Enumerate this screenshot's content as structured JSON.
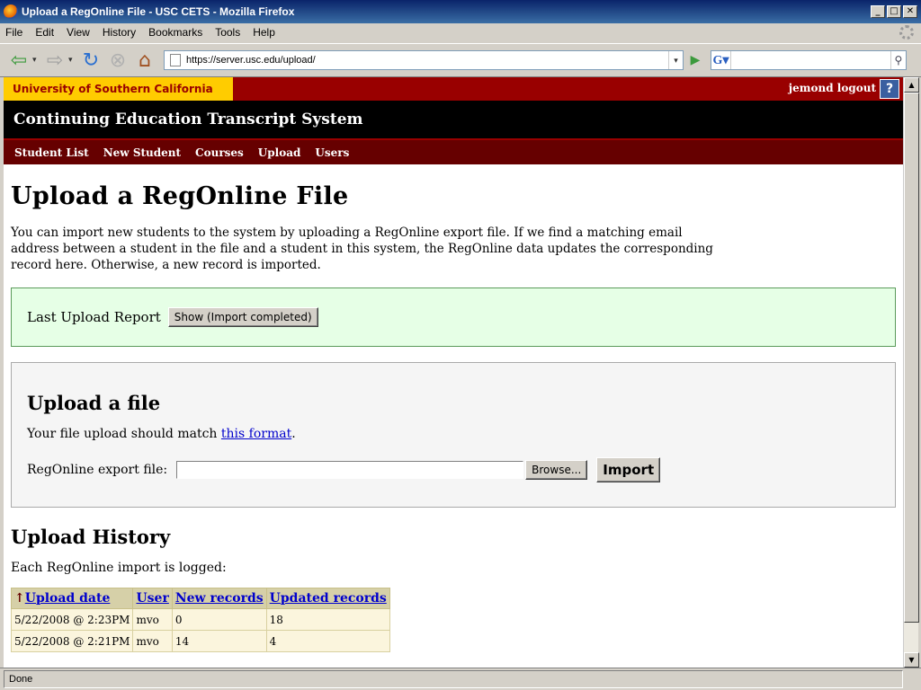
{
  "window": {
    "title": "Upload a RegOnline File - USC CETS - Mozilla Firefox",
    "min": "_",
    "max": "□",
    "close": "✕"
  },
  "menu": [
    "File",
    "Edit",
    "View",
    "History",
    "Bookmarks",
    "Tools",
    "Help"
  ],
  "browser": {
    "url": "https://server.usc.edu/upload/",
    "search_value": "",
    "status": "Done"
  },
  "site": {
    "university": "University of Southern California",
    "user_text": "jemond logout",
    "help_label": "?",
    "system_title": "Continuing Education Transcript System",
    "tabs": [
      "Student List",
      "New Student",
      "Courses",
      "Upload",
      "Users"
    ]
  },
  "page": {
    "title": "Upload a RegOnline File",
    "intro": "You can import new students to the system by uploading a RegOnline export file. If we find a matching email address between a student in the file and a student in this system, the RegOnline data updates the corresponding record here. Otherwise, a new record is imported.",
    "report_label": "Last Upload Report",
    "report_button": "Show (Import completed)",
    "upload_heading": "Upload a file",
    "format_prefix": "Your file upload should match ",
    "format_link": "this format",
    "format_suffix": ".",
    "file_label": "RegOnline export file:",
    "browse_button": "Browse...",
    "import_button": "Import",
    "history_heading": "Upload History",
    "history_note": "Each RegOnline import is logged:"
  },
  "history_table": {
    "sort_arrow": "↑",
    "headers": [
      "Upload date",
      "User",
      "New records",
      "Updated records"
    ],
    "rows": [
      [
        "5/22/2008 @ 2:23PM",
        "mvo",
        "0",
        "18"
      ],
      [
        "5/22/2008 @ 2:21PM",
        "mvo",
        "14",
        "4"
      ]
    ]
  }
}
